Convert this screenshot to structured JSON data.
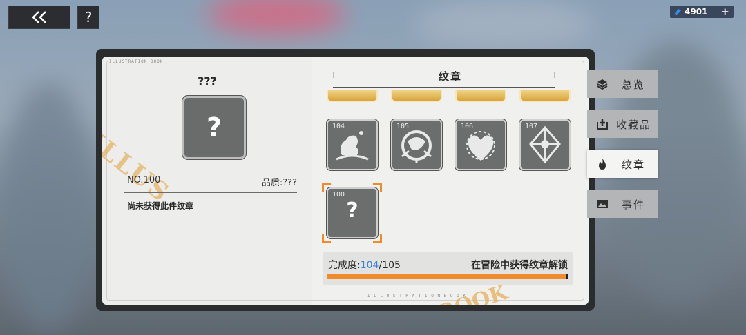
{
  "top": {
    "help_label": "?",
    "currency_amount": "4901",
    "plus_label": "+"
  },
  "book": {
    "left_page_tag": "ILLUSTRATION BOOK",
    "bottom_tag": "I L L U S T R A T I O N   B O O K",
    "watermark_left": "ILLUS",
    "watermark_bottom": "BOOK"
  },
  "detail": {
    "name": "???",
    "placeholder": "?",
    "number": "NO.100",
    "quality": "品质:???",
    "description": "尚未获得此件纹章"
  },
  "panel": {
    "title": "纹章",
    "badges": [
      {
        "num": "104"
      },
      {
        "num": "105"
      },
      {
        "num": "106"
      },
      {
        "num": "107"
      }
    ],
    "selected": {
      "num": "100",
      "placeholder": "?"
    },
    "progress": {
      "label": "完成度:",
      "current": "104",
      "separator": "/",
      "total": "105",
      "fraction": 0.99,
      "hint": "在冒险中获得纹章解锁",
      "color": "#f08a2a"
    }
  },
  "tabs": [
    {
      "label": "总览",
      "icon": "layers-icon"
    },
    {
      "label": "收藏品",
      "icon": "collection-add-icon"
    },
    {
      "label": "纹章",
      "icon": "flame-icon"
    },
    {
      "label": "事件",
      "icon": "image-icon"
    }
  ]
}
